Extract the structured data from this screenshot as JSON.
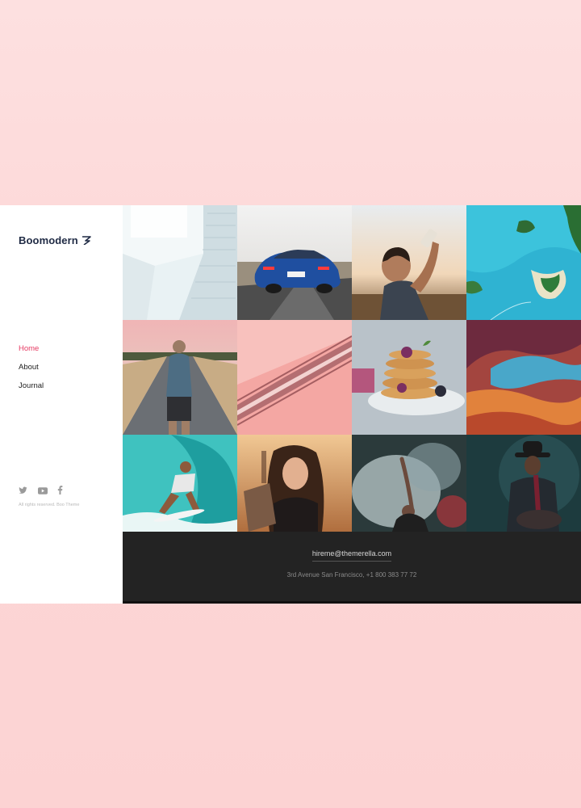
{
  "brand": {
    "name": "Boomodern"
  },
  "nav": {
    "items": [
      {
        "label": "Home",
        "active": true
      },
      {
        "label": "About",
        "active": false
      },
      {
        "label": "Journal",
        "active": false
      }
    ]
  },
  "social": {
    "icons": [
      "twitter-icon",
      "youtube-icon",
      "facebook-icon"
    ],
    "rights": "All rights reserved. Boo Theme"
  },
  "colors": {
    "accent": "#e63b63",
    "brand": "#1f2a44",
    "footer_bg": "#232323"
  },
  "gallery": {
    "tiles": [
      "white-architecture-photo",
      "blue-car-photo",
      "man-drinking-photo",
      "aerial-beach-photo",
      "man-on-road-photo",
      "pink-escalator-photo",
      "pancakes-photo",
      "canyon-photo",
      "surfer-photo",
      "woman-reading-photo",
      "dancer-smoke-photo",
      "guitarist-photo"
    ]
  },
  "footer": {
    "email": "hireme@themerella.com",
    "address": "3rd Avenue San Francisco,  +1 800 383 77 72"
  }
}
